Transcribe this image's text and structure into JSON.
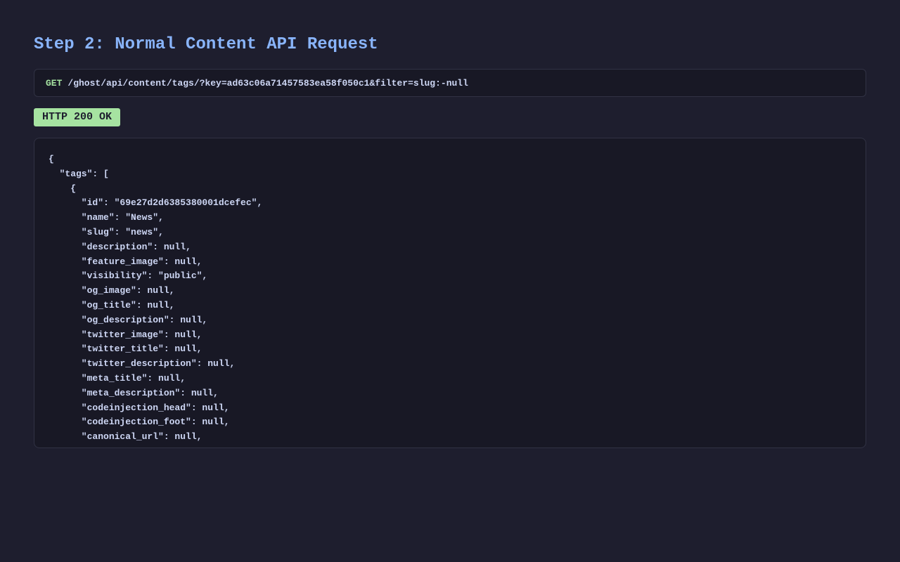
{
  "header": {
    "title": "Step 2: Normal Content API Request"
  },
  "request": {
    "method": "GET",
    "url": "/ghost/api/content/tags/?key=ad63c06a71457583ea58f050c1&filter=slug:-null"
  },
  "response": {
    "status": "HTTP 200 OK",
    "body": "{\n  \"tags\": [\n    {\n      \"id\": \"69e27d2d6385380001dcefec\",\n      \"name\": \"News\",\n      \"slug\": \"news\",\n      \"description\": null,\n      \"feature_image\": null,\n      \"visibility\": \"public\",\n      \"og_image\": null,\n      \"og_title\": null,\n      \"og_description\": null,\n      \"twitter_image\": null,\n      \"twitter_title\": null,\n      \"twitter_description\": null,\n      \"meta_title\": null,\n      \"meta_description\": null,\n      \"codeinjection_head\": null,\n      \"codeinjection_foot\": null,\n      \"canonical_url\": null,"
  },
  "colors": {
    "background": "#1e1e2e",
    "title": "#89b4fa",
    "method": "#a6e3a1",
    "status_badge": "#a6e3a1"
  }
}
